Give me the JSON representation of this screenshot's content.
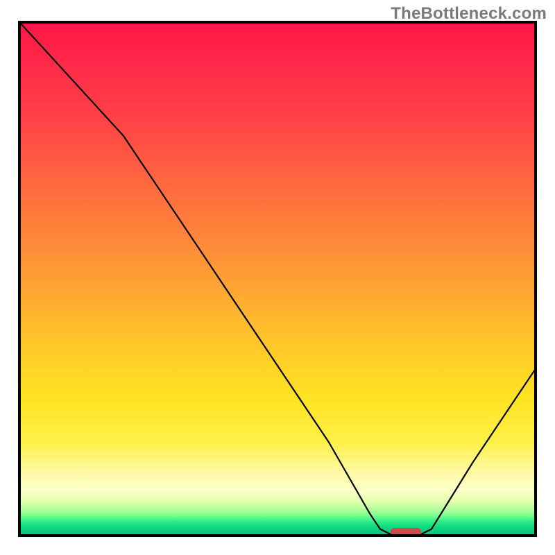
{
  "watermark": "TheBottleneck.com",
  "chart_data": {
    "type": "line",
    "title": "",
    "xlabel": "",
    "ylabel": "",
    "xlim": [
      0,
      100
    ],
    "ylim": [
      0,
      100
    ],
    "grid": false,
    "curve_points": [
      {
        "x": 0,
        "y": 100
      },
      {
        "x": 20,
        "y": 78
      },
      {
        "x": 24,
        "y": 72
      },
      {
        "x": 40,
        "y": 48
      },
      {
        "x": 60,
        "y": 18
      },
      {
        "x": 68,
        "y": 4
      },
      {
        "x": 70,
        "y": 1
      },
      {
        "x": 72,
        "y": 0
      },
      {
        "x": 78,
        "y": 0
      },
      {
        "x": 80,
        "y": 1
      },
      {
        "x": 88,
        "y": 14
      },
      {
        "x": 100,
        "y": 32
      }
    ],
    "minimum_marker": {
      "x_start": 72,
      "x_end": 78,
      "y": 0
    },
    "colors": {
      "top": "#ff1744",
      "mid": "#ffd027",
      "bottom": "#0cc47a",
      "curve": "#000000",
      "marker": "#d04a4a"
    }
  }
}
